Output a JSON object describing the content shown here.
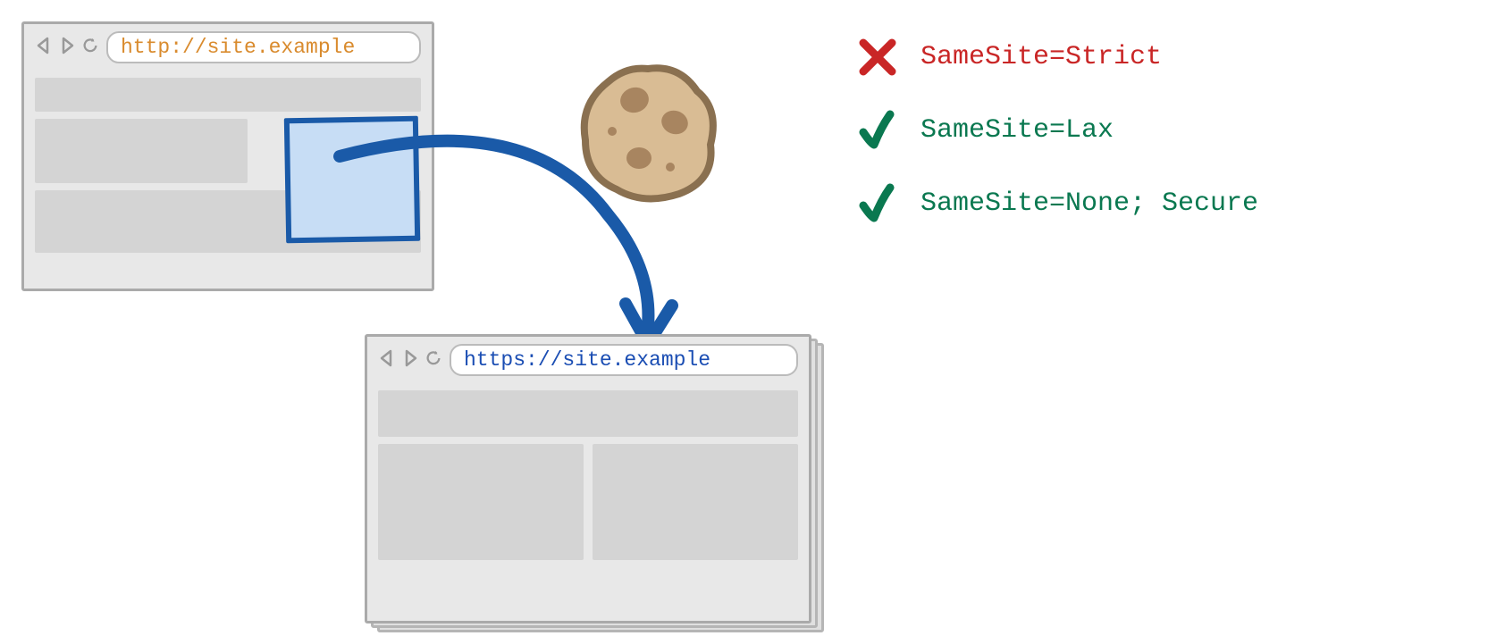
{
  "browser1": {
    "url": "http://site.example",
    "nav": {
      "back": "back",
      "forward": "forward",
      "reload": "reload"
    }
  },
  "browser2": {
    "url": "https://site.example",
    "nav": {
      "back": "back",
      "forward": "forward",
      "reload": "reload"
    }
  },
  "cookie": {
    "name": "cookie-icon"
  },
  "arrow": {
    "name": "navigation-arrow"
  },
  "samesite": {
    "items": [
      {
        "status": "cross",
        "label": "SameSite=Strict"
      },
      {
        "status": "check",
        "label": "SameSite=Lax"
      },
      {
        "status": "check",
        "label": "SameSite=None; Secure"
      }
    ]
  },
  "colors": {
    "cross": "#c92626",
    "check": "#0a7850",
    "http": "#d98b2e",
    "https": "#1a4db3",
    "arrow": "#1a5aa8"
  }
}
